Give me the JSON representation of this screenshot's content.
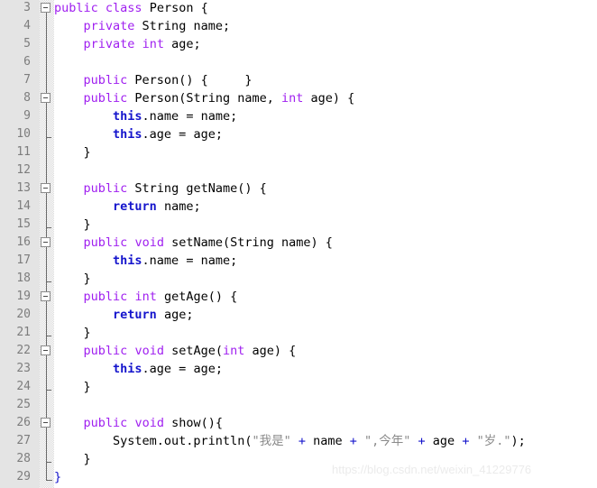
{
  "editor": {
    "language": "java",
    "line_height": 20,
    "first_line_number": 3,
    "last_line_number": 29,
    "colors": {
      "background": "#ffffff",
      "gutter_background": "#e4e4e4",
      "line_number": "#7d7d7d",
      "keyword": "#a020f0",
      "control_keyword": "#1414cc",
      "identifier": "#000000",
      "string": "#8a8a8a",
      "operator": "#1414cc",
      "fold_marker": "#8a8a8a"
    }
  },
  "line_numbers": [
    3,
    4,
    5,
    6,
    7,
    8,
    9,
    10,
    11,
    12,
    13,
    14,
    15,
    16,
    17,
    18,
    19,
    20,
    21,
    22,
    23,
    24,
    25,
    26,
    27,
    28,
    29
  ],
  "fold_markers": [
    {
      "line": 3,
      "type": "box"
    },
    {
      "line": 8,
      "type": "box"
    },
    {
      "line": 10,
      "type": "tick"
    },
    {
      "line": 13,
      "type": "box"
    },
    {
      "line": 15,
      "type": "tick"
    },
    {
      "line": 16,
      "type": "box"
    },
    {
      "line": 18,
      "type": "tick"
    },
    {
      "line": 19,
      "type": "box"
    },
    {
      "line": 21,
      "type": "tick"
    },
    {
      "line": 22,
      "type": "box"
    },
    {
      "line": 24,
      "type": "tick"
    },
    {
      "line": 26,
      "type": "box"
    },
    {
      "line": 28,
      "type": "tick"
    },
    {
      "line": 29,
      "type": "end"
    }
  ],
  "fold_lines": [
    {
      "from_line": 3,
      "to_line": 29
    },
    {
      "from_line": 8,
      "to_line": 10
    },
    {
      "from_line": 13,
      "to_line": 15
    },
    {
      "from_line": 16,
      "to_line": 18
    },
    {
      "from_line": 19,
      "to_line": 21
    },
    {
      "from_line": 22,
      "to_line": 24
    },
    {
      "from_line": 26,
      "to_line": 28
    }
  ],
  "code_lines": [
    {
      "line": 3,
      "tokens": [
        {
          "t": "public",
          "k": "keyword"
        },
        {
          "t": " ",
          "k": "plain"
        },
        {
          "t": "class",
          "k": "keyword"
        },
        {
          "t": " Person {",
          "k": "plain"
        }
      ]
    },
    {
      "line": 4,
      "tokens": [
        {
          "t": "    ",
          "k": "plain"
        },
        {
          "t": "private",
          "k": "keyword"
        },
        {
          "t": " String name;",
          "k": "plain"
        }
      ]
    },
    {
      "line": 5,
      "tokens": [
        {
          "t": "    ",
          "k": "plain"
        },
        {
          "t": "private",
          "k": "keyword"
        },
        {
          "t": " ",
          "k": "plain"
        },
        {
          "t": "int",
          "k": "keyword"
        },
        {
          "t": " age;",
          "k": "plain"
        }
      ]
    },
    {
      "line": 6,
      "tokens": []
    },
    {
      "line": 7,
      "tokens": [
        {
          "t": "    ",
          "k": "plain"
        },
        {
          "t": "public",
          "k": "keyword"
        },
        {
          "t": " Person() {     }",
          "k": "plain"
        }
      ]
    },
    {
      "line": 8,
      "tokens": [
        {
          "t": "    ",
          "k": "plain"
        },
        {
          "t": "public",
          "k": "keyword"
        },
        {
          "t": " Person(String name, ",
          "k": "plain"
        },
        {
          "t": "int",
          "k": "keyword"
        },
        {
          "t": " age) {",
          "k": "plain"
        }
      ]
    },
    {
      "line": 9,
      "tokens": [
        {
          "t": "        ",
          "k": "plain"
        },
        {
          "t": "this",
          "k": "control"
        },
        {
          "t": ".name = name;",
          "k": "plain"
        }
      ]
    },
    {
      "line": 10,
      "tokens": [
        {
          "t": "        ",
          "k": "plain"
        },
        {
          "t": "this",
          "k": "control"
        },
        {
          "t": ".age = age;",
          "k": "plain"
        }
      ]
    },
    {
      "line": 11,
      "tokens": [
        {
          "t": "    }",
          "k": "plain"
        }
      ]
    },
    {
      "line": 12,
      "tokens": []
    },
    {
      "line": 13,
      "tokens": [
        {
          "t": "    ",
          "k": "plain"
        },
        {
          "t": "public",
          "k": "keyword"
        },
        {
          "t": " String getName() {",
          "k": "plain"
        }
      ]
    },
    {
      "line": 14,
      "tokens": [
        {
          "t": "        ",
          "k": "plain"
        },
        {
          "t": "return",
          "k": "control"
        },
        {
          "t": " name;",
          "k": "plain"
        }
      ]
    },
    {
      "line": 15,
      "tokens": [
        {
          "t": "    }",
          "k": "plain"
        }
      ]
    },
    {
      "line": 16,
      "tokens": [
        {
          "t": "    ",
          "k": "plain"
        },
        {
          "t": "public",
          "k": "keyword"
        },
        {
          "t": " ",
          "k": "plain"
        },
        {
          "t": "void",
          "k": "keyword"
        },
        {
          "t": " setName(String name) {",
          "k": "plain"
        }
      ]
    },
    {
      "line": 17,
      "tokens": [
        {
          "t": "        ",
          "k": "plain"
        },
        {
          "t": "this",
          "k": "control"
        },
        {
          "t": ".name = name;",
          "k": "plain"
        }
      ]
    },
    {
      "line": 18,
      "tokens": [
        {
          "t": "    }",
          "k": "plain"
        }
      ]
    },
    {
      "line": 19,
      "tokens": [
        {
          "t": "    ",
          "k": "plain"
        },
        {
          "t": "public",
          "k": "keyword"
        },
        {
          "t": " ",
          "k": "plain"
        },
        {
          "t": "int",
          "k": "keyword"
        },
        {
          "t": " getAge() {",
          "k": "plain"
        }
      ]
    },
    {
      "line": 20,
      "tokens": [
        {
          "t": "        ",
          "k": "plain"
        },
        {
          "t": "return",
          "k": "control"
        },
        {
          "t": " age;",
          "k": "plain"
        }
      ]
    },
    {
      "line": 21,
      "tokens": [
        {
          "t": "    }",
          "k": "plain"
        }
      ]
    },
    {
      "line": 22,
      "tokens": [
        {
          "t": "    ",
          "k": "plain"
        },
        {
          "t": "public",
          "k": "keyword"
        },
        {
          "t": " ",
          "k": "plain"
        },
        {
          "t": "void",
          "k": "keyword"
        },
        {
          "t": " setAge(",
          "k": "plain"
        },
        {
          "t": "int",
          "k": "keyword"
        },
        {
          "t": " age) {",
          "k": "plain"
        }
      ]
    },
    {
      "line": 23,
      "tokens": [
        {
          "t": "        ",
          "k": "plain"
        },
        {
          "t": "this",
          "k": "control"
        },
        {
          "t": ".age = age;",
          "k": "plain"
        }
      ]
    },
    {
      "line": 24,
      "tokens": [
        {
          "t": "    }",
          "k": "plain"
        }
      ]
    },
    {
      "line": 25,
      "tokens": []
    },
    {
      "line": 26,
      "tokens": [
        {
          "t": "    ",
          "k": "plain"
        },
        {
          "t": "public",
          "k": "keyword"
        },
        {
          "t": " ",
          "k": "plain"
        },
        {
          "t": "void",
          "k": "keyword"
        },
        {
          "t": " show(){",
          "k": "plain"
        }
      ]
    },
    {
      "line": 27,
      "tokens": [
        {
          "t": "        System.out.println(",
          "k": "plain"
        },
        {
          "t": "\"我是\"",
          "k": "string"
        },
        {
          "t": " + ",
          "k": "op"
        },
        {
          "t": "name",
          "k": "plain"
        },
        {
          "t": " + ",
          "k": "op"
        },
        {
          "t": "\",今年\"",
          "k": "string"
        },
        {
          "t": " + ",
          "k": "op"
        },
        {
          "t": "age",
          "k": "plain"
        },
        {
          "t": " + ",
          "k": "op"
        },
        {
          "t": "\"岁.\"",
          "k": "string"
        },
        {
          "t": ");",
          "k": "plain"
        }
      ]
    },
    {
      "line": 28,
      "tokens": [
        {
          "t": "    }",
          "k": "plain"
        }
      ]
    },
    {
      "line": 29,
      "tokens": [
        {
          "t": "}",
          "k": "brace-blue"
        }
      ]
    }
  ],
  "watermark": {
    "text": "https://blog.csdn.net/weixin_41229776"
  }
}
